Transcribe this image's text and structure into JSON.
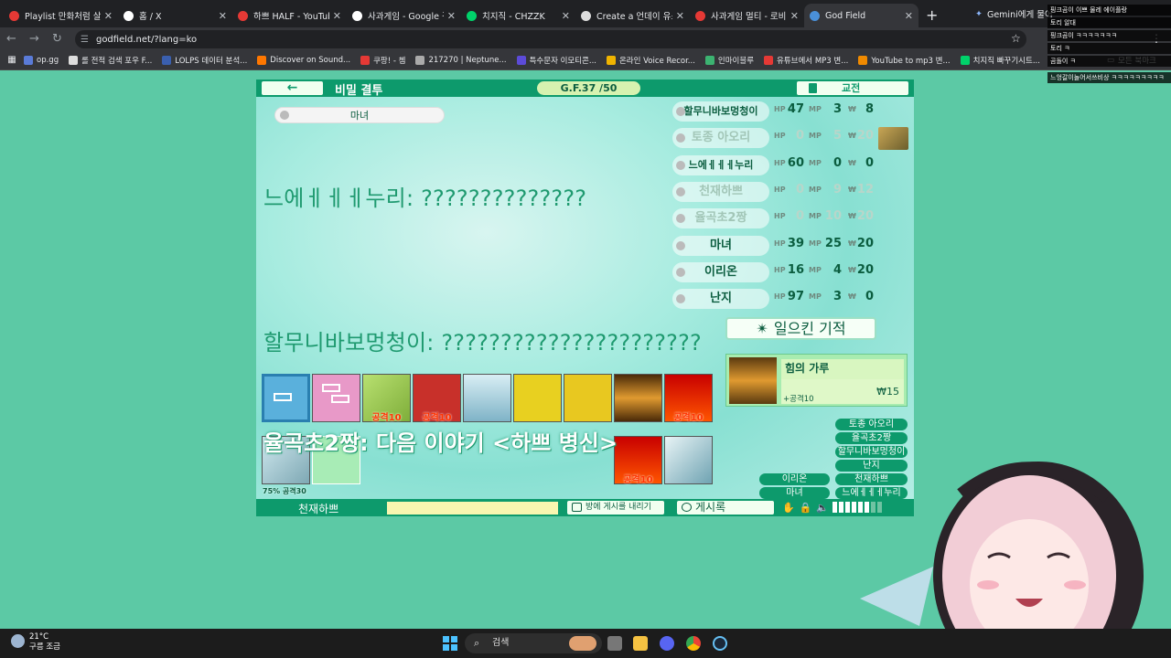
{
  "browser": {
    "tabs": [
      {
        "title": "Playlist 만화처럼 살고",
        "color": "#e53935"
      },
      {
        "title": "홈 / X",
        "color": "#ffffff"
      },
      {
        "title": "하쁘 HALF - YouTube",
        "color": "#e53935"
      },
      {
        "title": "사과게임 - Google 검",
        "color": "#ffffff"
      },
      {
        "title": "치지직 - CHZZK",
        "color": "#00d26a"
      },
      {
        "title": "Create a 언데이 유스",
        "color": "#dddddd"
      },
      {
        "title": "사과게임 멀티 - 로비",
        "color": "#e53935"
      },
      {
        "title": "God Field",
        "color": "#4a90d9",
        "active": true
      }
    ],
    "gemini_tab": "Gemini에게 물어",
    "url": "godfield.net/?lang=ko",
    "bookmarks": [
      {
        "label": "op.gg",
        "color": "#5a7bd8"
      },
      {
        "label": "롤 전적 검색 포우 F...",
        "color": "#dddddd"
      },
      {
        "label": "LOLPS 데이터 분석...",
        "color": "#3a5fae"
      },
      {
        "label": "Discover on Sound...",
        "color": "#ff7700"
      },
      {
        "label": "쿠팡! - 쳄",
        "color": "#e53935"
      },
      {
        "label": "217270 | Neptune...",
        "color": "#aaaaaa"
      },
      {
        "label": "특수문자 이모티콘...",
        "color": "#5c4bd8"
      },
      {
        "label": "온라인 Voice Recor...",
        "color": "#f0b400"
      },
      {
        "label": "인마이블루",
        "color": "#3cb371"
      },
      {
        "label": "유튜브에서 MP3 변...",
        "color": "#e53935"
      },
      {
        "label": "YouTube to mp3 변...",
        "color": "#f08a00"
      },
      {
        "label": "치지직 빠꾸기시트...",
        "color": "#00d26a"
      }
    ],
    "all_bookmarks": "모든 북마크"
  },
  "game": {
    "back_label": "←",
    "mode_title": "비밀 결투",
    "gf_badge": "G.F.37 /50",
    "war_button": "교전",
    "target_name": "마녀",
    "speech1": "느에ㅔㅔㅔ누리: ??????????????",
    "speech2": "할무니바보멍청이: ??????????????????????",
    "overlay_text": "율곡초2짱: 다음 이야기 <하쁘 병신>",
    "players": [
      {
        "name": "할무니바보멍청이",
        "hp": "47",
        "mp": "3",
        "gold": "8",
        "dim": false,
        "small": true
      },
      {
        "name": "토종 아오리",
        "hp": "0",
        "mp": "5",
        "gold": "20",
        "dim": true,
        "small": false
      },
      {
        "name": "느에ㅔㅔㅔ누리",
        "hp": "60",
        "mp": "0",
        "gold": "0",
        "dim": false,
        "small": true
      },
      {
        "name": "천재하쁘",
        "hp": "0",
        "mp": "9",
        "gold": "12",
        "dim": true,
        "small": false
      },
      {
        "name": "율곡초2짱",
        "hp": "0",
        "mp": "10",
        "gold": "20",
        "dim": true,
        "small": false
      },
      {
        "name": "마녀",
        "hp": "39",
        "mp": "25",
        "gold": "20",
        "dim": false,
        "small": false
      },
      {
        "name": "이리온",
        "hp": "16",
        "mp": "4",
        "gold": "20",
        "dim": false,
        "small": false
      },
      {
        "name": "난지",
        "hp": "97",
        "mp": "3",
        "gold": "0",
        "dim": false,
        "small": false
      }
    ],
    "stat_labels": {
      "hp": "HP",
      "mp": "MP",
      "gold": "₩"
    },
    "miracle_button": "일으킨 기적",
    "item": {
      "name": "힘의 가루",
      "desc": "+공격10",
      "price": "₩15"
    },
    "card_labels": {
      "attack10": "공격10",
      "pct": "75% 공격30"
    },
    "name_buttons": [
      "토종 아오리",
      "율곡초2짱",
      "할무니바보멍청이",
      "난지",
      "천재하쁘",
      "느에ㅔㅔㅔ누리",
      "이리온",
      "마녀"
    ],
    "bottom": {
      "turn": "천재하쁘",
      "post_button": "방에 게시를 내리기",
      "log_button": "게시록"
    }
  },
  "taskbar": {
    "temp": "21°C",
    "weather": "구름 조금",
    "search": "검색"
  },
  "chat": [
    "핑크곰이 이쁘 물레 에이플랑",
    "토리 알대",
    "핑크곰이 ㅋㅋㅋㅋㅋㅋㅋ",
    "토리 ㅋ",
    "곰돌이 ㅋ",
    "느엉갈이놀어서쓰비상 ㅋㅋㅋㅋㅋㅋㅋㅋㅋ"
  ]
}
